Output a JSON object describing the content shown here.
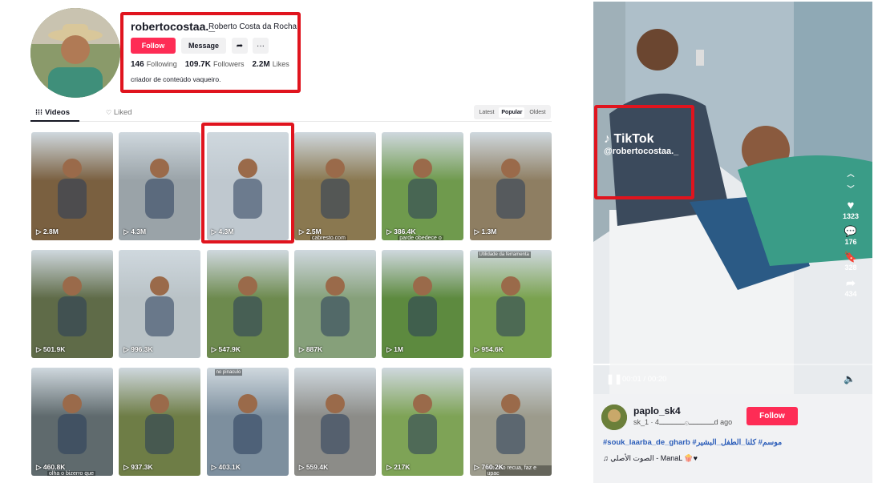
{
  "profile": {
    "username": "robertocostaa._",
    "nickname": "Roberto Costa da Rocha",
    "follow_label": "Follow",
    "message_label": "Message",
    "following_count": "146",
    "following_label": "Following",
    "followers_count": "109.7K",
    "followers_label": "Followers",
    "likes_count": "2.2M",
    "likes_label": "Likes",
    "bio": "criador de conteúdo vaqueiro."
  },
  "tabs": {
    "videos": "Videos",
    "liked": "Liked"
  },
  "sort": {
    "latest": "Latest",
    "popular": "Popular",
    "oldest": "Oldest"
  },
  "videos": [
    {
      "views": "2.8M",
      "bg": "#7a6040"
    },
    {
      "views": "4.3M",
      "bg": "#9aa3a8"
    },
    {
      "views": "4.3M",
      "bg": "#bfc8cf"
    },
    {
      "views": "2.5M",
      "bg": "#8a7850",
      "cap": "cabresto.com"
    },
    {
      "views": "386.4K",
      "bg": "#6f9a4d",
      "cap": "parde obedece o"
    },
    {
      "views": "1.3M",
      "bg": "#8e7e62"
    },
    {
      "views": "501.9K",
      "bg": "#5f6b48"
    },
    {
      "views": "996.3K",
      "bg": "#b9c2c6"
    },
    {
      "views": "547.9K",
      "bg": "#6d8a4e"
    },
    {
      "views": "887K",
      "bg": "#86a07a"
    },
    {
      "views": "1M",
      "bg": "#5d8a3f"
    },
    {
      "views": "954.6K",
      "bg": "#7aa24f",
      "topcap": "Utilidade da ferramenta"
    },
    {
      "views": "460.8K",
      "bg": "#5f6a6d",
      "cap": "olha o bizerro que"
    },
    {
      "views": "937.3K",
      "bg": "#6e7d46"
    },
    {
      "views": "403.1K",
      "bg": "#7d8f9e",
      "topcap": "no pinaculo"
    },
    {
      "views": "559.4K",
      "bg": "#8c8c88"
    },
    {
      "views": "217K",
      "bg": "#7ea356"
    },
    {
      "views": "760.2K",
      "bg": "#9c9b8c",
      "cap": "ele não recua, faz e upac"
    }
  ],
  "player": {
    "watermark_logo": "TikTok",
    "watermark_user": "@robertocostaa._",
    "likes": "1323",
    "comments": "176",
    "saves": "328",
    "shares": "434",
    "time": "00:01 / 00:20",
    "progress": 0.06
  },
  "post": {
    "author": "paplo_sk4",
    "sub_name": "sk_ــــــ۞ــــــ4",
    "sub_time": "· 1d ago",
    "follow_label": "Follow",
    "hashtags": "#souk_laarba_de_gharb #موسم# كلنا_الطفل_البشير",
    "music": "♫ الصوت الأصلي - ManaL 🍿♥"
  },
  "colors": {
    "accent": "#fe2c55",
    "highlight": "#e0141e",
    "hashtag": "#2b5db9"
  }
}
